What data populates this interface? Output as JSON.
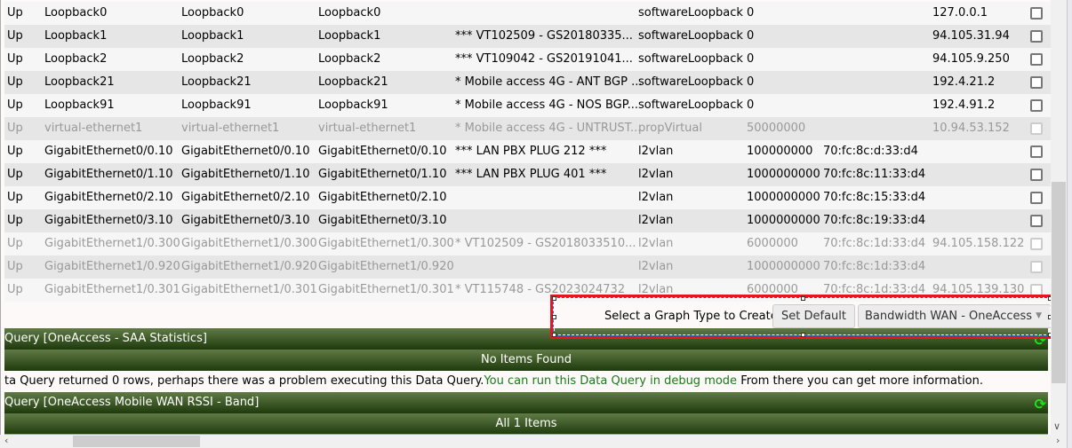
{
  "rows": [
    {
      "status": "Up",
      "index": "Loopback0",
      "name": "Loopback0",
      "descr": "Loopback0",
      "alias": "",
      "type": "softwareLoopback",
      "speed": "0",
      "mac": "",
      "ip": "127.0.0.1",
      "disabled": false
    },
    {
      "status": "Up",
      "index": "Loopback1",
      "name": "Loopback1",
      "descr": "Loopback1",
      "alias": "*** VT102509 - GS20180335...",
      "type": "softwareLoopback",
      "speed": "0",
      "mac": "",
      "ip": "94.105.31.94",
      "disabled": false
    },
    {
      "status": "Up",
      "index": "Loopback2",
      "name": "Loopback2",
      "descr": "Loopback2",
      "alias": "*** VT109042 - GS20191041...",
      "type": "softwareLoopback",
      "speed": "0",
      "mac": "",
      "ip": "94.105.9.250",
      "disabled": false
    },
    {
      "status": "Up",
      "index": "Loopback21",
      "name": "Loopback21",
      "descr": "Loopback21",
      "alias": "* Mobile access 4G - ANT BGP ...",
      "type": "softwareLoopback",
      "speed": "0",
      "mac": "",
      "ip": "192.4.21.2",
      "disabled": false
    },
    {
      "status": "Up",
      "index": "Loopback91",
      "name": "Loopback91",
      "descr": "Loopback91",
      "alias": "* Mobile access 4G - NOS BGP...",
      "type": "softwareLoopback",
      "speed": "0",
      "mac": "",
      "ip": "192.4.91.2",
      "disabled": false
    },
    {
      "status": "Up",
      "index": "virtual-ethernet1",
      "name": "virtual-ethernet1",
      "descr": "virtual-ethernet1",
      "alias": "* Mobile access 4G - UNTRUST...",
      "type": "propVirtual",
      "speed": "50000000",
      "mac": "",
      "ip": "10.94.53.152",
      "disabled": true
    },
    {
      "status": "Up",
      "index": "GigabitEthernet0/0.10",
      "name": "GigabitEthernet0/0.10",
      "descr": "GigabitEthernet0/0.10",
      "alias": "*** LAN PBX PLUG 212 ***",
      "type": "l2vlan",
      "speed": "100000000",
      "mac": "70:fc:8c:d:33:d4",
      "ip": "",
      "disabled": false
    },
    {
      "status": "Up",
      "index": "GigabitEthernet0/1.10",
      "name": "GigabitEthernet0/1.10",
      "descr": "GigabitEthernet0/1.10",
      "alias": "*** LAN PBX PLUG 401 ***",
      "type": "l2vlan",
      "speed": "1000000000",
      "mac": "70:fc:8c:11:33:d4",
      "ip": "",
      "disabled": false
    },
    {
      "status": "Up",
      "index": "GigabitEthernet0/2.10",
      "name": "GigabitEthernet0/2.10",
      "descr": "GigabitEthernet0/2.10",
      "alias": "",
      "type": "l2vlan",
      "speed": "1000000000",
      "mac": "70:fc:8c:15:33:d4",
      "ip": "",
      "disabled": false
    },
    {
      "status": "Up",
      "index": "GigabitEthernet0/3.10",
      "name": "GigabitEthernet0/3.10",
      "descr": "GigabitEthernet0/3.10",
      "alias": "",
      "type": "l2vlan",
      "speed": "1000000000",
      "mac": "70:fc:8c:19:33:d4",
      "ip": "",
      "disabled": false
    },
    {
      "status": "Up",
      "index": "GigabitEthernet1/0.300",
      "name": "GigabitEthernet1/0.300",
      "descr": "GigabitEthernet1/0.300",
      "alias": "* VT102509 - GS2018033510...",
      "type": "l2vlan",
      "speed": "6000000",
      "mac": "70:fc:8c:1d:33:d4",
      "ip": "94.105.158.122",
      "disabled": true
    },
    {
      "status": "Up",
      "index": "GigabitEthernet1/0.920",
      "name": "GigabitEthernet1/0.920",
      "descr": "GigabitEthernet1/0.920",
      "alias": "",
      "type": "l2vlan",
      "speed": "1000000000",
      "mac": "70:fc:8c:1d:33:d4",
      "ip": "",
      "disabled": true
    },
    {
      "status": "Up",
      "index": "GigabitEthernet1/0.301",
      "name": "GigabitEthernet1/0.301",
      "descr": "GigabitEthernet1/0.301",
      "alias": "* VT115748 - GS2023024732",
      "type": "l2vlan",
      "speed": "6000000",
      "mac": "70:fc:8c:1d:33:d4",
      "ip": "94.105.139.130",
      "disabled": true
    }
  ],
  "graph": {
    "label": "Select a Graph Type to Create",
    "set_default": "Set Default",
    "selected": "Bandwidth WAN - OneAccess"
  },
  "sections": [
    {
      "title": "Query [OneAccess - SAA Statistics]",
      "status": "No Items Found",
      "message": "ta Query returned 0 rows, perhaps there was a problem executing this Data Query.",
      "link": "You can run this Data Query in debug mode",
      "message_tail": " From there you can get more information."
    },
    {
      "title": "Query [OneAccess Mobile WAN RSSI - Band]",
      "status": "All 1 Items"
    }
  ],
  "colors": {
    "header_top": "#5f7a45",
    "header_bottom": "#1e3a0c",
    "refresh": "#19e619",
    "link": "#1a7a1a",
    "highlight": "#e8141e"
  }
}
